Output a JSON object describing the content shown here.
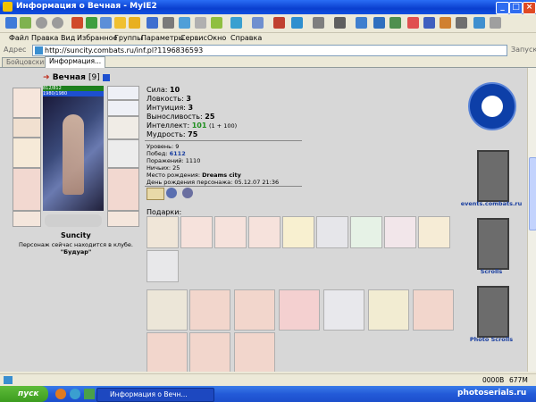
{
  "window": {
    "title": "Информация о Вечная - MyIE2",
    "min_label": "_",
    "max_label": "□",
    "close_label": "×"
  },
  "menu": [
    "Файл",
    "Правка",
    "Вид",
    "Избранное",
    "Группы",
    "Параметры",
    "Сервис",
    "Окно",
    "Справка"
  ],
  "address": {
    "label": "Адрес",
    "url": "http://suncity.combats.ru/inf.pl?1196836593",
    "go_label": "Запуск"
  },
  "tabs": [
    {
      "label": "Бойцовский ...",
      "active": false
    },
    {
      "label": "Информация...",
      "active": true
    }
  ],
  "character": {
    "name": "Вечная",
    "level": "[9]",
    "hp": "812/812",
    "mana": "1980/1980",
    "city": "Suncity",
    "location_text": "Персонаж сейчас находится в клубе.",
    "location_room": "\"Будуар\""
  },
  "stats": [
    {
      "label": "Сила:",
      "value": "10",
      "extra": ""
    },
    {
      "label": "Ловкость:",
      "value": "3",
      "extra": ""
    },
    {
      "label": "Интуиция:",
      "value": "3",
      "extra": ""
    },
    {
      "label": "Выносливость:",
      "value": "25",
      "extra": ""
    },
    {
      "label": "Интеллект:",
      "value": "101",
      "extra": "(1 + 100)"
    },
    {
      "label": "Мудрость:",
      "value": "75",
      "extra": ""
    }
  ],
  "info": {
    "level": "Уровень: 9",
    "wins_label": "Побед:",
    "wins": "6112",
    "losses": "Поражений: 1110",
    "draws": "Ничьих: 25",
    "birthplace_label": "Место рождения:",
    "birthplace": "Dreams city",
    "birthday": "День рождения персонажа: 05.12.07 21:36"
  },
  "gifts_label": "Подарки:",
  "badges": {
    "events_label": "events.combats.ru",
    "scrolls_label": "Scrolls",
    "photo_label": "Photo Scrolls"
  },
  "status": {
    "size": "0000B",
    "mem": "677M"
  },
  "taskbar": {
    "start_label": "пуск",
    "task_label": "Информация о Вечн...",
    "watermark": "photoserials.ru"
  },
  "colors": {
    "accent_blue": "#0d3fa8",
    "level_green": "#1f8f1f",
    "hp_green": "#1d7f1d",
    "mana_blue": "#1d4fd0",
    "wins_blue": "#1a3fa0"
  }
}
